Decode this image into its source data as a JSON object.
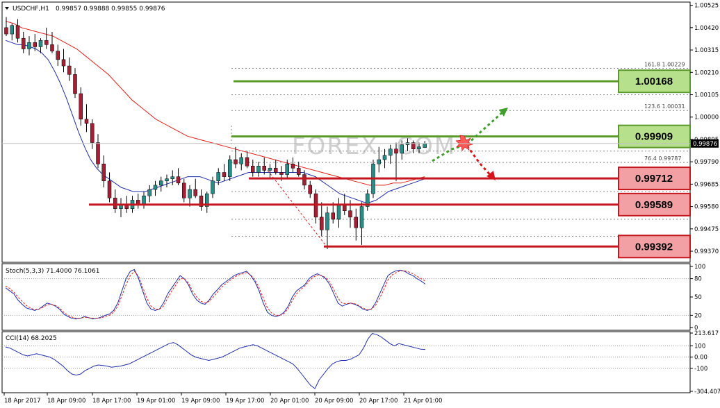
{
  "chart_header": {
    "symbol_label": "USDCHF,H1",
    "ohlc": "0.99857 0.99888 0.99855 0.99876"
  },
  "watermark": "FOREX  .COM",
  "chart_data": [
    {
      "type": "candlestick",
      "title": "USDCHF,H1",
      "ylim": [
        0.99318,
        1.0054
      ],
      "y_ticks": [
        "1.00525",
        "1.00420",
        "1.00315",
        "1.00210",
        "1.00105",
        "1.00000",
        "0.99895",
        "0.99790",
        "0.99685",
        "0.99580",
        "0.99475",
        "0.99370"
      ],
      "current_price": "0.99876",
      "x_labels": [
        "18 Apr 2017",
        "18 Apr 09:00",
        "18 Apr 17:00",
        "19 Apr 01:00",
        "19 Apr 09:00",
        "19 Apr 17:00",
        "20 Apr 01:00",
        "20 Apr 09:00",
        "20 Apr 17:00",
        "21 Apr 01:00"
      ],
      "candles": [
        [
          1.0042,
          1.0047,
          1.0038,
          1.0039
        ],
        [
          1.0039,
          1.0044,
          1.0036,
          1.0043
        ],
        [
          1.0043,
          1.0046,
          1.0035,
          1.0037
        ],
        [
          1.0037,
          1.004,
          1.003,
          1.0032
        ],
        [
          1.0032,
          1.0038,
          1.0029,
          1.0035
        ],
        [
          1.0035,
          1.0039,
          1.0031,
          1.0033
        ],
        [
          1.0033,
          1.0037,
          1.003,
          1.0036
        ],
        [
          1.0036,
          1.0042,
          1.0032,
          1.0034
        ],
        [
          1.0034,
          1.004,
          1.003,
          1.0031
        ],
        [
          1.0031,
          1.0034,
          1.0024,
          1.0027
        ],
        [
          1.0027,
          1.0032,
          1.0021,
          1.0024
        ],
        [
          1.0024,
          1.0028,
          1.0017,
          1.002
        ],
        [
          1.002,
          1.0023,
          1.0009,
          1.0011
        ],
        [
          1.0011,
          1.0014,
          0.9996,
          0.9999
        ],
        [
          0.9999,
          1.0006,
          0.9993,
          0.9997
        ],
        [
          0.9997,
          0.9999,
          0.9985,
          0.9988
        ],
        [
          0.9988,
          0.9992,
          0.9976,
          0.9978
        ],
        [
          0.9978,
          0.9982,
          0.9967,
          0.997
        ],
        [
          0.997,
          0.9974,
          0.996,
          0.9962
        ],
        [
          0.9962,
          0.9966,
          0.9955,
          0.9957
        ],
        [
          0.9957,
          0.9962,
          0.9953,
          0.9959
        ],
        [
          0.9959,
          0.9963,
          0.9955,
          0.9957
        ],
        [
          0.9957,
          0.9963,
          0.9955,
          0.9961
        ],
        [
          0.9961,
          0.9964,
          0.9957,
          0.9959
        ],
        [
          0.9959,
          0.9965,
          0.9957,
          0.9963
        ],
        [
          0.9963,
          0.9968,
          0.996,
          0.9966
        ],
        [
          0.9966,
          0.997,
          0.9963,
          0.9968
        ],
        [
          0.9968,
          0.9972,
          0.9965,
          0.997
        ],
        [
          0.997,
          0.9973,
          0.9967,
          0.9971
        ],
        [
          0.9971,
          0.9975,
          0.9968,
          0.9972
        ],
        [
          0.9972,
          0.9976,
          0.9968,
          0.9969
        ],
        [
          0.9969,
          0.9971,
          0.996,
          0.9962
        ],
        [
          0.9962,
          0.9968,
          0.9958,
          0.9966
        ],
        [
          0.9966,
          0.9971,
          0.9962,
          0.9963
        ],
        [
          0.9963,
          0.9966,
          0.9956,
          0.9958
        ],
        [
          0.9958,
          0.9965,
          0.9955,
          0.9964
        ],
        [
          0.9964,
          0.9972,
          0.9962,
          0.997
        ],
        [
          0.997,
          0.9976,
          0.9968,
          0.9974
        ],
        [
          0.9974,
          0.9978,
          0.997,
          0.9972
        ],
        [
          0.9972,
          0.9982,
          0.997,
          0.998
        ],
        [
          0.998,
          0.9986,
          0.9976,
          0.9978
        ],
        [
          0.9978,
          0.9983,
          0.9975,
          0.9981
        ],
        [
          0.9981,
          0.9984,
          0.9976,
          0.9977
        ],
        [
          0.9977,
          0.998,
          0.9972,
          0.9974
        ],
        [
          0.9974,
          0.9979,
          0.9972,
          0.9977
        ],
        [
          0.9977,
          0.9981,
          0.9973,
          0.9975
        ],
        [
          0.9975,
          0.9978,
          0.9971,
          0.9976
        ],
        [
          0.9976,
          0.998,
          0.9973,
          0.9974
        ],
        [
          0.9974,
          0.9977,
          0.997,
          0.9973
        ],
        [
          0.9973,
          0.998,
          0.9971,
          0.9978
        ],
        [
          0.9978,
          0.9981,
          0.9974,
          0.9976
        ],
        [
          0.9976,
          0.9979,
          0.9972,
          0.9973
        ],
        [
          0.9973,
          0.9975,
          0.9966,
          0.9968
        ],
        [
          0.9968,
          0.997,
          0.9962,
          0.9964
        ],
        [
          0.9964,
          0.9966,
          0.995,
          0.9953
        ],
        [
          0.9953,
          0.996,
          0.9944,
          0.9947
        ],
        [
          0.9947,
          0.9958,
          0.9938,
          0.9955
        ],
        [
          0.9955,
          0.996,
          0.995,
          0.9952
        ],
        [
          0.9952,
          0.9962,
          0.9948,
          0.9959
        ],
        [
          0.9959,
          0.9964,
          0.9954,
          0.9956
        ],
        [
          0.9956,
          0.9961,
          0.9948,
          0.9953
        ],
        [
          0.9953,
          0.9957,
          0.9942,
          0.9948
        ],
        [
          0.9948,
          0.996,
          0.994,
          0.9958
        ],
        [
          0.9958,
          0.9966,
          0.9956,
          0.9964
        ],
        [
          0.9964,
          0.998,
          0.9962,
          0.9978
        ],
        [
          0.9978,
          0.9986,
          0.9974,
          0.998
        ],
        [
          0.998,
          0.9985,
          0.9976,
          0.9982
        ],
        [
          0.9982,
          0.9987,
          0.9978,
          0.9985
        ],
        [
          0.9985,
          0.9988,
          0.997,
          0.9983
        ],
        [
          0.9983,
          0.9989,
          0.998,
          0.9987
        ],
        [
          0.9987,
          0.999,
          0.9984,
          0.9988
        ],
        [
          0.9988,
          0.9989,
          0.9983,
          0.9985
        ],
        [
          0.9985,
          0.9988,
          0.9983,
          0.9986
        ],
        [
          0.99857,
          0.99888,
          0.99855,
          0.99876
        ]
      ],
      "ma_blue": [
        1.0036,
        1.0035,
        1.0034,
        1.0034,
        1.0033,
        1.0032,
        1.003,
        1.0027,
        1.0022,
        1.0016,
        1.0009,
        1.0001,
        0.9993,
        0.9986,
        0.998,
        0.9976,
        0.9973,
        0.9971,
        0.9969,
        0.9967,
        0.9966,
        0.9965,
        0.9965,
        0.9965,
        0.9966,
        0.9967,
        0.9968,
        0.9969,
        0.997,
        0.9971,
        0.9972,
        0.9972,
        0.9972,
        0.9971,
        0.997,
        0.9969,
        0.997,
        0.9971,
        0.9972,
        0.9973,
        0.9974,
        0.9974,
        0.9974,
        0.9974,
        0.9974,
        0.9974,
        0.9974,
        0.9974,
        0.9974,
        0.9974,
        0.9973,
        0.9972,
        0.997,
        0.9968,
        0.9966,
        0.9964,
        0.9963,
        0.9962,
        0.9961,
        0.996,
        0.996,
        0.9961,
        0.9963,
        0.9965,
        0.9966,
        0.9967,
        0.9968,
        0.9969,
        0.997,
        0.9971
      ],
      "ma_red": [
        1.0045,
        1.0044,
        1.0042,
        1.0041,
        1.004,
        1.0039,
        1.0038,
        1.0036,
        1.0034,
        1.0032,
        1.0029,
        1.0026,
        1.0023,
        1.002,
        1.0016,
        1.0012,
        1.0008,
        1.0005,
        1.0002,
        0.9999,
        0.9997,
        0.9995,
        0.9993,
        0.9991,
        0.999,
        0.9989,
        0.9988,
        0.9987,
        0.9986,
        0.9985,
        0.9984,
        0.9983,
        0.9982,
        0.9981,
        0.998,
        0.9979,
        0.9978,
        0.9977,
        0.9976,
        0.9975,
        0.9974,
        0.9973,
        0.9972,
        0.9971,
        0.997,
        0.9969,
        0.9968,
        0.9968,
        0.9968,
        0.9969,
        0.9969,
        0.997,
        0.9971,
        0.9972
      ],
      "horizontal_levels": [
        {
          "label": "1.00168",
          "value": 1.00168,
          "color": "#5a9a2a",
          "fill": "#b7e08c"
        },
        {
          "label": "0.99909",
          "value": 0.99909,
          "color": "#5a9a2a",
          "fill": "#b7e08c"
        },
        {
          "label": "0.99712",
          "value": 0.99712,
          "color": "#c4161c",
          "fill": "#f2a0a4"
        },
        {
          "label": "0.99589",
          "value": 0.99589,
          "color": "#c4161c",
          "fill": "#f2a0a4"
        },
        {
          "label": "0.99392",
          "value": 0.99392,
          "color": "#c4161c",
          "fill": "#f2a0a4"
        }
      ],
      "fibonacci": [
        {
          "label": "161.8",
          "price": "1.00229",
          "value": 1.00229
        },
        {
          "label": "123.6",
          "price": "1.00031",
          "value": 1.00031
        },
        {
          "label": "76.4",
          "price": "0.99787",
          "value": 0.99787
        }
      ]
    },
    {
      "type": "line",
      "title": "Stoch(5,3,3) 71.4000 76.1061",
      "ylim": [
        0,
        100
      ],
      "y_ticks": [
        "100",
        "80",
        "50",
        "20",
        "0"
      ],
      "main": [
        65,
        60,
        55,
        45,
        38,
        32,
        30,
        28,
        30,
        35,
        40,
        38,
        35,
        30,
        22,
        18,
        15,
        14,
        15,
        18,
        16,
        14,
        15,
        17,
        20,
        22,
        28,
        40,
        60,
        80,
        92,
        95,
        80,
        60,
        40,
        30,
        28,
        30,
        40,
        55,
        65,
        75,
        85,
        80,
        70,
        55,
        45,
        40,
        38,
        45,
        55,
        62,
        70,
        75,
        80,
        85,
        88,
        90,
        92,
        85,
        75,
        60,
        40,
        25,
        20,
        18,
        20,
        25,
        35,
        50,
        60,
        65,
        70,
        80,
        85,
        88,
        85,
        80,
        70,
        55,
        40,
        35,
        38,
        40,
        38,
        35,
        30,
        28,
        30,
        40,
        55,
        70,
        85,
        90,
        93,
        94,
        92,
        88,
        85,
        80,
        76,
        71
      ],
      "signal": [
        68,
        64,
        58,
        50,
        43,
        36,
        32,
        29,
        30,
        33,
        37,
        38,
        36,
        32,
        25,
        20,
        17,
        15,
        15,
        17,
        16,
        15,
        15,
        16,
        18,
        20,
        25,
        35,
        52,
        70,
        85,
        92,
        84,
        66,
        48,
        35,
        30,
        30,
        35,
        48,
        60,
        70,
        80,
        80,
        73,
        60,
        50,
        43,
        40,
        43,
        50,
        58,
        66,
        72,
        77,
        82,
        86,
        88,
        90,
        86,
        78,
        65,
        48,
        32,
        24,
        20,
        20,
        23,
        31,
        44,
        55,
        62,
        68,
        76,
        82,
        86,
        85,
        82,
        74,
        62,
        48,
        40,
        39,
        40,
        39,
        36,
        32,
        29,
        30,
        36,
        48,
        62,
        78,
        86,
        90,
        93,
        93,
        91,
        88,
        84,
        80,
        76
      ]
    },
    {
      "type": "line",
      "title": "CCI(14) 68.2025",
      "ylim": [
        -304.4077,
        213.617
      ],
      "y_ticks": [
        "213.617",
        "100",
        "0.00",
        "-100",
        "-304.4077"
      ],
      "values": [
        90,
        80,
        60,
        40,
        20,
        10,
        20,
        30,
        20,
        10,
        0,
        -20,
        -50,
        -80,
        -120,
        -150,
        -160,
        -150,
        -120,
        -100,
        -80,
        -70,
        -75,
        -80,
        -90,
        -85,
        -80,
        -70,
        -60,
        -40,
        -20,
        0,
        20,
        40,
        60,
        80,
        100,
        120,
        130,
        110,
        80,
        50,
        20,
        0,
        -10,
        -20,
        -30,
        -20,
        -10,
        0,
        20,
        40,
        60,
        80,
        90,
        100,
        110,
        100,
        80,
        60,
        40,
        20,
        0,
        -20,
        -40,
        -60,
        -100,
        -150,
        -200,
        -250,
        -280,
        -200,
        -150,
        -100,
        -60,
        -40,
        -30,
        -30,
        -20,
        0,
        20,
        80,
        160,
        210,
        200,
        180,
        150,
        120,
        100,
        120,
        110,
        100,
        90,
        80,
        70,
        68
      ]
    }
  ]
}
